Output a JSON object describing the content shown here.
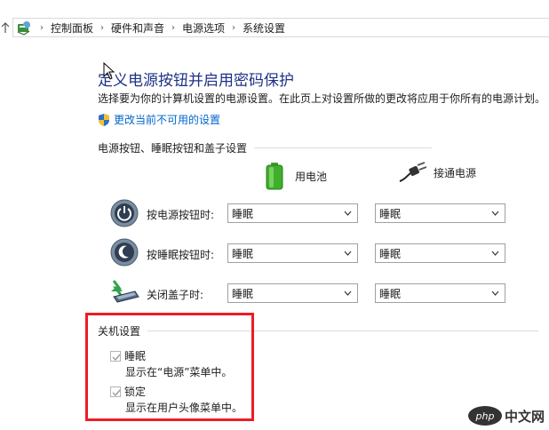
{
  "breadcrumb": [
    "控制面板",
    "硬件和声音",
    "电源选项",
    "系统设置"
  ],
  "page": {
    "title": "定义电源按钮并启用密码保护",
    "description": "选择要为你的计算机设置的电源设置。在此页上对设置所做的更改将应用于你所有的电源计划。",
    "change_link": "更改当前不可用的设置"
  },
  "power_section": {
    "header": "电源按钮、睡眠按钮和盖子设置",
    "battery_label": "用电池",
    "plugged_label": "接通电源",
    "rows": [
      {
        "label": "按电源按钮时:",
        "battery": "睡眠",
        "plugged": "睡眠",
        "icon": "power-button-icon"
      },
      {
        "label": "按睡眠按钮时:",
        "battery": "睡眠",
        "plugged": "睡眠",
        "icon": "sleep-button-icon"
      },
      {
        "label": "关闭盖子时:",
        "battery": "睡眠",
        "plugged": "睡眠",
        "icon": "laptop-lid-icon"
      }
    ]
  },
  "shutdown_section": {
    "header": "关机设置",
    "items": [
      {
        "label": "睡眠",
        "sub": "显示在“电源”菜单中。",
        "checked": true
      },
      {
        "label": "锁定",
        "sub": "显示在用户头像菜单中。",
        "checked": true
      }
    ]
  },
  "watermark": {
    "text": "中文网",
    "logo": "php"
  },
  "colors": {
    "title": "#1e3287",
    "link": "#0066cc",
    "highlight": "#ee1c25"
  }
}
